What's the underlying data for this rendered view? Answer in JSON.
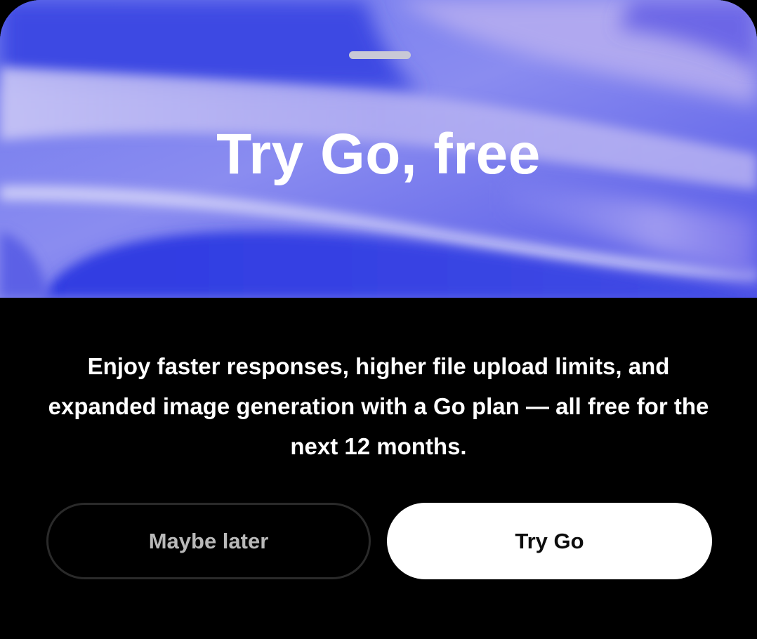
{
  "hero": {
    "title": "Try Go, free"
  },
  "body": {
    "description": "Enjoy faster responses, higher file upload limits, and expanded image generation with a Go plan — all free for the next 12 months."
  },
  "actions": {
    "secondary_label": "Maybe later",
    "primary_label": "Try Go"
  },
  "colors": {
    "background": "#000000",
    "hero_blue": "#3a45e6",
    "hero_lavender": "#9d98f0",
    "primary_button_bg": "#ffffff",
    "primary_button_text": "#0d0d0d",
    "secondary_button_text": "#b9b9b9",
    "secondary_button_border": "#2a2a2a"
  }
}
